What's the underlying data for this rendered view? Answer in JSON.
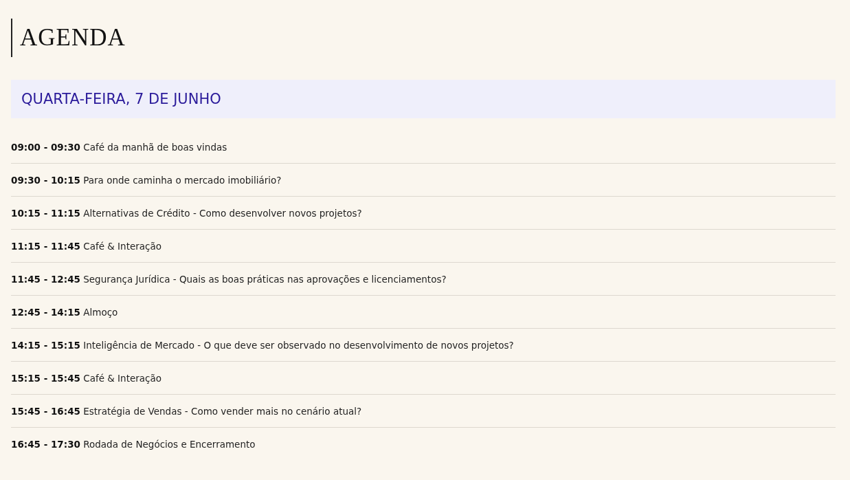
{
  "page_title": "AGENDA",
  "day": {
    "heading": "QUARTA-FEIRA, 7 DE JUNHO"
  },
  "sessions": [
    {
      "text": "**09:00 - 09:30** Café da manhã de boas vindas"
    },
    {
      "text": "**09:30 - 10:15** Para onde caminha o mercado imobiliário?"
    },
    {
      "text": "**10:15 - 11:15** Alternativas de Crédito - Como desenvolver novos projetos?"
    },
    {
      "text": "**11:15 - 11:45** Café & Interação"
    },
    {
      "text": "**11:45 - 12:45** Segurança Jurídica - Quais as boas práticas nas aprovações e licenciamentos?"
    },
    {
      "text": "**12:45 - 14:15** Almoço"
    },
    {
      "text": "**14:15 - 15:15** Inteligência de Mercado - O que deve ser observado no desenvolvimento de novos projetos?"
    },
    {
      "text": "**15:15 - 15:45** Café & Interação"
    },
    {
      "text": "**15:45 - 16:45** Estratégia de Vendas - Como vender mais no cenário atual?"
    },
    {
      "text": "**16:45 - 17:30** Rodada de Negócios e Encerramento"
    }
  ]
}
